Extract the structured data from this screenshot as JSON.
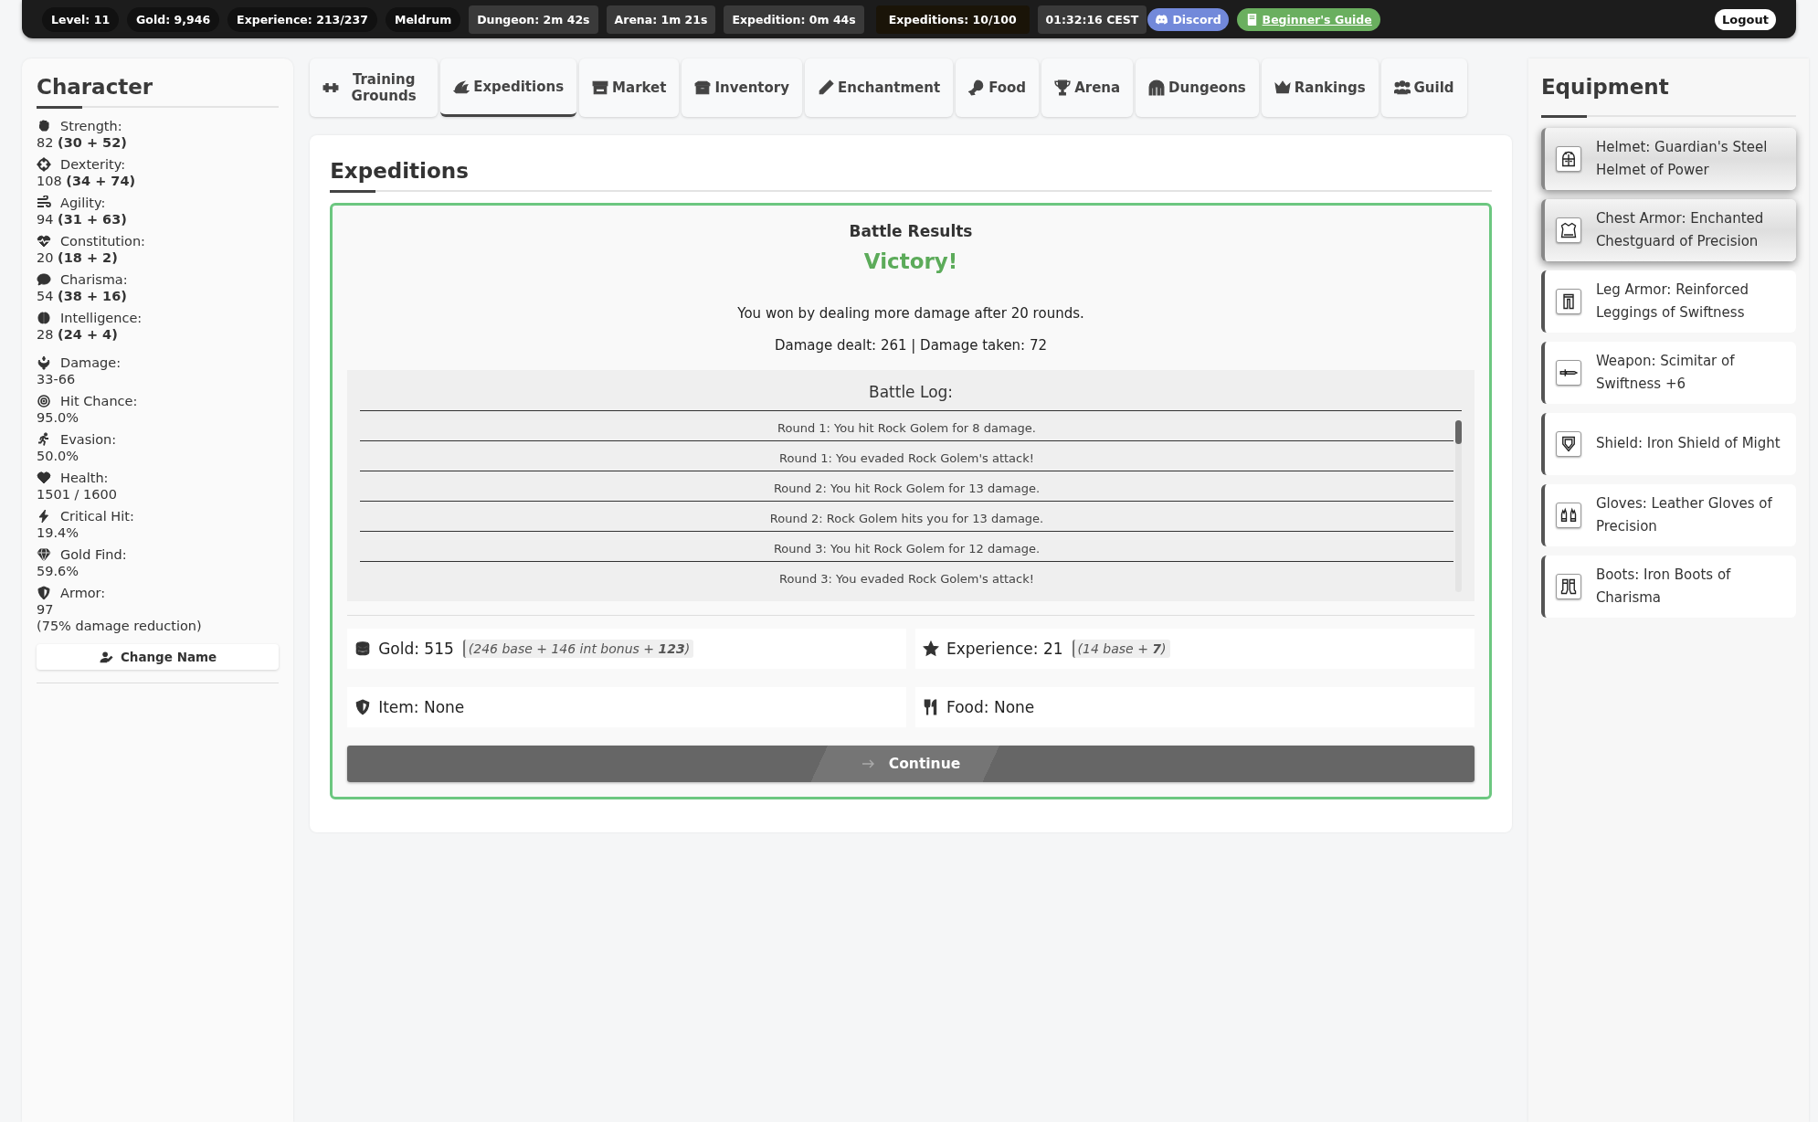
{
  "top_bar": {
    "items": [
      {
        "kind": "pill",
        "text": "Level: 11"
      },
      {
        "kind": "pill",
        "text": "Gold: 9,946"
      },
      {
        "kind": "pill",
        "text": "Experience: 213/237"
      },
      {
        "kind": "pill",
        "text": "Meldrum"
      },
      {
        "kind": "timer",
        "text": "Dungeon: 2m 42s"
      },
      {
        "kind": "timer",
        "text": "Arena: 1m 21s"
      },
      {
        "kind": "timer",
        "text": "Expedition: 0m 44s"
      },
      {
        "kind": "counter",
        "text": "Expeditions: 10/100"
      },
      {
        "kind": "timer",
        "text": "01:32:16 CEST"
      },
      {
        "kind": "discord",
        "text": "Discord"
      },
      {
        "kind": "guide",
        "text": "Beginner's Guide"
      }
    ],
    "logout": "Logout"
  },
  "character": {
    "title": "Character",
    "stats": [
      {
        "label": "Strength:",
        "value": "82 **(30 + 52)**"
      },
      {
        "label": "Dexterity:",
        "value": "108 **(34 + 74)**"
      },
      {
        "label": "Agility:",
        "value": "94 **(31 + 63)**"
      },
      {
        "label": "Constitution:",
        "value": "20 **(18 + 2)**"
      },
      {
        "label": "Charisma:",
        "value": "54 **(38 + 16)**"
      },
      {
        "label": "Intelligence:",
        "value": "28 **(24 + 4)**"
      }
    ],
    "derived": [
      {
        "label": "Damage:",
        "value": "33-66"
      },
      {
        "label": "Hit Chance:",
        "value": "95.0%"
      },
      {
        "label": "Evasion:",
        "value": "50.0%"
      },
      {
        "label": "Health:",
        "value": "1501 / 1600"
      },
      {
        "label": "Critical Hit:",
        "value": "19.4%"
      },
      {
        "label": "Gold Find:",
        "value": "59.6%"
      },
      {
        "label": "Armor:",
        "value": "97",
        "note": "(75% damage reduction)"
      }
    ],
    "change_name": "Change Name"
  },
  "tabs": [
    {
      "label": "Training Grounds",
      "selected": false
    },
    {
      "label": "Expeditions",
      "selected": true
    },
    {
      "label": "Market",
      "selected": false
    },
    {
      "label": "Inventory",
      "selected": false
    },
    {
      "label": "Enchantment",
      "selected": false
    },
    {
      "label": "Food",
      "selected": false
    },
    {
      "label": "Arena",
      "selected": false
    },
    {
      "label": "Dungeons",
      "selected": false
    },
    {
      "label": "Rankings",
      "selected": false
    },
    {
      "label": "Guild",
      "selected": false
    }
  ],
  "main": {
    "title": "Expeditions",
    "results": {
      "heading": "Battle Results",
      "outcome": "Victory!",
      "summary": "You won by dealing more damage after 20 rounds.",
      "damage": "Damage dealt: 261 | Damage taken: 72",
      "log_title": "Battle Log:",
      "log": [
        "Round 1: You hit Rock Golem for 8 damage.",
        "Round 1: You evaded Rock Golem's attack!",
        "Round 2: You hit Rock Golem for 13 damage.",
        "Round 2: Rock Golem hits you for 13 damage.",
        "Round 3: You hit Rock Golem for 12 damage.",
        "Round 3: You evaded Rock Golem's attack!"
      ],
      "rewards": [
        {
          "kind": "gold",
          "text": "Gold: 515",
          "detail": "(246 base + 146 int bonus + **123**)"
        },
        {
          "kind": "experience",
          "text": "Experience: 21",
          "detail": "(14 base + **7**)"
        },
        {
          "kind": "item",
          "text": "Item: None"
        },
        {
          "kind": "food",
          "text": "Food: None"
        }
      ],
      "continue": "Continue"
    }
  },
  "equipment": {
    "title": "Equipment",
    "items": [
      {
        "kind": "helmet",
        "text": "Helmet: Guardian's Steel Helmet of Power",
        "highlighted": true
      },
      {
        "kind": "chest",
        "text": "Chest Armor: Enchanted Chestguard of Precision",
        "highlighted": true
      },
      {
        "kind": "legs",
        "text": "Leg Armor: Reinforced Leggings of Swiftness",
        "highlighted": false
      },
      {
        "kind": "weapon",
        "text": "Weapon: Scimitar of Swiftness +6",
        "highlighted": false
      },
      {
        "kind": "shield",
        "text": "Shield: Iron Shield of Might",
        "highlighted": false
      },
      {
        "kind": "gloves",
        "text": "Gloves: Leather Gloves of Precision",
        "highlighted": false
      },
      {
        "kind": "boots",
        "text": "Boots: Iron Boots of Charisma",
        "highlighted": false
      }
    ]
  }
}
